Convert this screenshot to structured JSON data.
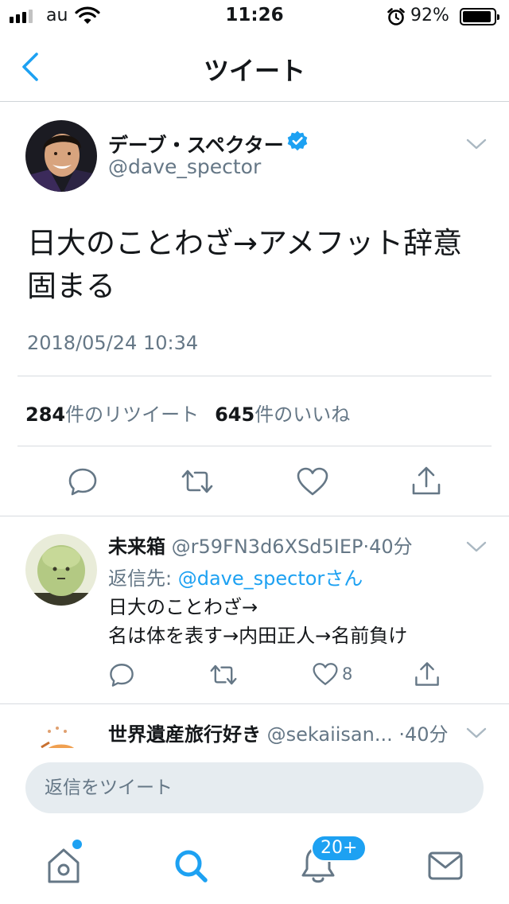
{
  "status_bar": {
    "carrier": "au",
    "time": "11:26",
    "battery": "92%",
    "battery_level": 0.92
  },
  "nav": {
    "title": "ツイート",
    "back_icon": "chevron-left-icon"
  },
  "tweet": {
    "author_name": "デーブ・スペクター",
    "author_handle": "@dave_spector",
    "verified": true,
    "text": "日大のことわざ→アメフット辞意固まる",
    "timestamp": "2018/05/24 10:34",
    "retweets_count": "284",
    "retweets_label": "件のリツイート",
    "likes_count": "645",
    "likes_label": "件のいいね"
  },
  "replies": [
    {
      "name": "未来箱",
      "handle": "@r59FN3d6XSd5IEP",
      "time": "·40分",
      "reply_prefix": "返信先: ",
      "reply_to": "@dave_spectorさん",
      "text_lines": [
        "日大のことわざ→",
        "名は体を表す→内田正人→名前負け"
      ],
      "like_count": "8"
    },
    {
      "name": "世界遺産旅行好き",
      "handle": "@sekaiisan...",
      "time": "·40分"
    }
  ],
  "composer": {
    "placeholder": "返信をツイート"
  },
  "tab_bar": {
    "items": [
      "home-icon",
      "search-icon",
      "notifications-icon",
      "messages-icon"
    ],
    "notifications_badge": "20+"
  },
  "colors": {
    "accent": "#1da1f2",
    "secondary_text": "#657786",
    "divider": "#d7dbe0",
    "icon_gray": "#657786"
  }
}
